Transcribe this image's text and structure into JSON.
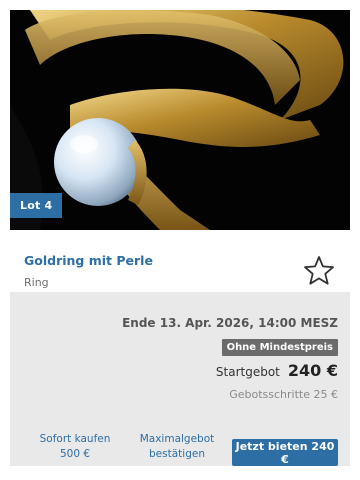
{
  "lot": {
    "badge": "Lot 4",
    "image_alt": "gold ring with pearl on black background"
  },
  "item": {
    "title": "Goldring mit Perle",
    "category": "Ring",
    "favorite_icon": "star-outline-icon"
  },
  "bidding": {
    "end_time": "Ende 13. Apr. 2026, 14:00 MESZ",
    "no_reserve": "Ohne Mindestpreis",
    "start_label": "Startgebot",
    "start_price": "240 €",
    "increment": "Gebotsschritte 25 €"
  },
  "actions": {
    "buy_now_label": "Sofort kaufen",
    "buy_now_price": "500 €",
    "max_bid_line1": "Maximalgebot",
    "max_bid_line2": "bestätigen",
    "bid_now": "Jetzt bieten 240 €"
  },
  "colors": {
    "accent": "#2d6ea5",
    "panel": "#e9e9e9",
    "badge_gray": "#6b6b6b"
  }
}
